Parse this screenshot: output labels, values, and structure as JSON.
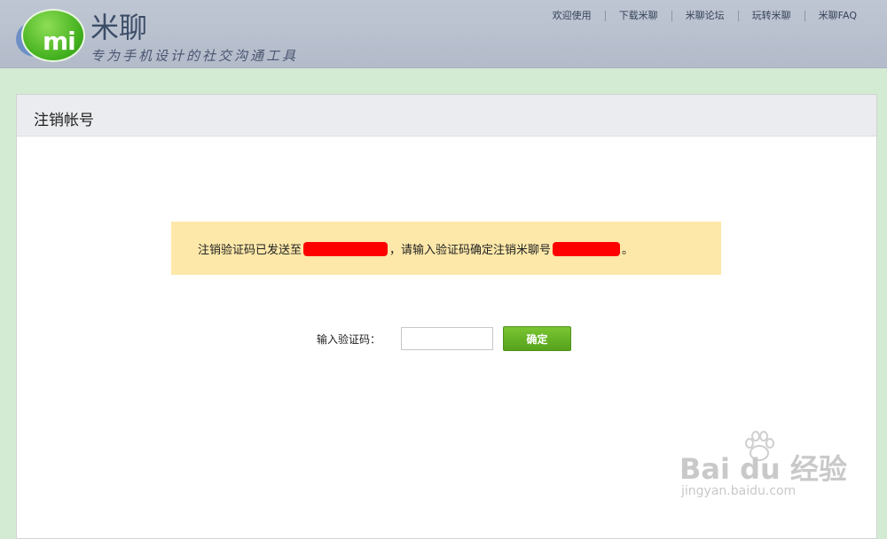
{
  "header": {
    "logo_text": "mi",
    "app_name": "米聊",
    "slogan": "专为手机设计的社交沟通工具",
    "nav": [
      "欢迎使用",
      "下载米聊",
      "米聊论坛",
      "玩转米聊",
      "米聊FAQ"
    ]
  },
  "panel": {
    "title": "注销帐号"
  },
  "notice": {
    "prefix": "注销验证码已发送至",
    "middle": "，请输入验证码确定注销米聊号",
    "suffix": "。"
  },
  "form": {
    "label": "输入验证码：",
    "input_value": "",
    "confirm_label": "确定"
  },
  "watermark": {
    "logo": "Bai du 经验",
    "url": "jingyan.baidu.com"
  },
  "colors": {
    "header_bg": "#b9c1cf",
    "page_bg": "#d3ebd3",
    "notice_bg": "#fde8a9",
    "button_green": "#62ad22",
    "redaction": "#ff0000"
  }
}
